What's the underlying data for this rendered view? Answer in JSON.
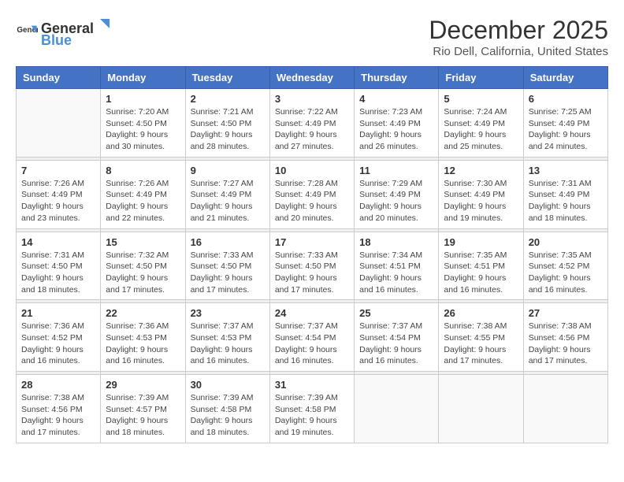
{
  "logo": {
    "general": "General",
    "blue": "Blue"
  },
  "title": "December 2025",
  "subtitle": "Rio Dell, California, United States",
  "headers": [
    "Sunday",
    "Monday",
    "Tuesday",
    "Wednesday",
    "Thursday",
    "Friday",
    "Saturday"
  ],
  "weeks": [
    [
      {
        "day": "",
        "sunrise": "",
        "sunset": "",
        "daylight": ""
      },
      {
        "day": "1",
        "sunrise": "Sunrise: 7:20 AM",
        "sunset": "Sunset: 4:50 PM",
        "daylight": "Daylight: 9 hours and 30 minutes."
      },
      {
        "day": "2",
        "sunrise": "Sunrise: 7:21 AM",
        "sunset": "Sunset: 4:50 PM",
        "daylight": "Daylight: 9 hours and 28 minutes."
      },
      {
        "day": "3",
        "sunrise": "Sunrise: 7:22 AM",
        "sunset": "Sunset: 4:49 PM",
        "daylight": "Daylight: 9 hours and 27 minutes."
      },
      {
        "day": "4",
        "sunrise": "Sunrise: 7:23 AM",
        "sunset": "Sunset: 4:49 PM",
        "daylight": "Daylight: 9 hours and 26 minutes."
      },
      {
        "day": "5",
        "sunrise": "Sunrise: 7:24 AM",
        "sunset": "Sunset: 4:49 PM",
        "daylight": "Daylight: 9 hours and 25 minutes."
      },
      {
        "day": "6",
        "sunrise": "Sunrise: 7:25 AM",
        "sunset": "Sunset: 4:49 PM",
        "daylight": "Daylight: 9 hours and 24 minutes."
      }
    ],
    [
      {
        "day": "7",
        "sunrise": "Sunrise: 7:26 AM",
        "sunset": "Sunset: 4:49 PM",
        "daylight": "Daylight: 9 hours and 23 minutes."
      },
      {
        "day": "8",
        "sunrise": "Sunrise: 7:26 AM",
        "sunset": "Sunset: 4:49 PM",
        "daylight": "Daylight: 9 hours and 22 minutes."
      },
      {
        "day": "9",
        "sunrise": "Sunrise: 7:27 AM",
        "sunset": "Sunset: 4:49 PM",
        "daylight": "Daylight: 9 hours and 21 minutes."
      },
      {
        "day": "10",
        "sunrise": "Sunrise: 7:28 AM",
        "sunset": "Sunset: 4:49 PM",
        "daylight": "Daylight: 9 hours and 20 minutes."
      },
      {
        "day": "11",
        "sunrise": "Sunrise: 7:29 AM",
        "sunset": "Sunset: 4:49 PM",
        "daylight": "Daylight: 9 hours and 20 minutes."
      },
      {
        "day": "12",
        "sunrise": "Sunrise: 7:30 AM",
        "sunset": "Sunset: 4:49 PM",
        "daylight": "Daylight: 9 hours and 19 minutes."
      },
      {
        "day": "13",
        "sunrise": "Sunrise: 7:31 AM",
        "sunset": "Sunset: 4:49 PM",
        "daylight": "Daylight: 9 hours and 18 minutes."
      }
    ],
    [
      {
        "day": "14",
        "sunrise": "Sunrise: 7:31 AM",
        "sunset": "Sunset: 4:50 PM",
        "daylight": "Daylight: 9 hours and 18 minutes."
      },
      {
        "day": "15",
        "sunrise": "Sunrise: 7:32 AM",
        "sunset": "Sunset: 4:50 PM",
        "daylight": "Daylight: 9 hours and 17 minutes."
      },
      {
        "day": "16",
        "sunrise": "Sunrise: 7:33 AM",
        "sunset": "Sunset: 4:50 PM",
        "daylight": "Daylight: 9 hours and 17 minutes."
      },
      {
        "day": "17",
        "sunrise": "Sunrise: 7:33 AM",
        "sunset": "Sunset: 4:50 PM",
        "daylight": "Daylight: 9 hours and 17 minutes."
      },
      {
        "day": "18",
        "sunrise": "Sunrise: 7:34 AM",
        "sunset": "Sunset: 4:51 PM",
        "daylight": "Daylight: 9 hours and 16 minutes."
      },
      {
        "day": "19",
        "sunrise": "Sunrise: 7:35 AM",
        "sunset": "Sunset: 4:51 PM",
        "daylight": "Daylight: 9 hours and 16 minutes."
      },
      {
        "day": "20",
        "sunrise": "Sunrise: 7:35 AM",
        "sunset": "Sunset: 4:52 PM",
        "daylight": "Daylight: 9 hours and 16 minutes."
      }
    ],
    [
      {
        "day": "21",
        "sunrise": "Sunrise: 7:36 AM",
        "sunset": "Sunset: 4:52 PM",
        "daylight": "Daylight: 9 hours and 16 minutes."
      },
      {
        "day": "22",
        "sunrise": "Sunrise: 7:36 AM",
        "sunset": "Sunset: 4:53 PM",
        "daylight": "Daylight: 9 hours and 16 minutes."
      },
      {
        "day": "23",
        "sunrise": "Sunrise: 7:37 AM",
        "sunset": "Sunset: 4:53 PM",
        "daylight": "Daylight: 9 hours and 16 minutes."
      },
      {
        "day": "24",
        "sunrise": "Sunrise: 7:37 AM",
        "sunset": "Sunset: 4:54 PM",
        "daylight": "Daylight: 9 hours and 16 minutes."
      },
      {
        "day": "25",
        "sunrise": "Sunrise: 7:37 AM",
        "sunset": "Sunset: 4:54 PM",
        "daylight": "Daylight: 9 hours and 16 minutes."
      },
      {
        "day": "26",
        "sunrise": "Sunrise: 7:38 AM",
        "sunset": "Sunset: 4:55 PM",
        "daylight": "Daylight: 9 hours and 17 minutes."
      },
      {
        "day": "27",
        "sunrise": "Sunrise: 7:38 AM",
        "sunset": "Sunset: 4:56 PM",
        "daylight": "Daylight: 9 hours and 17 minutes."
      }
    ],
    [
      {
        "day": "28",
        "sunrise": "Sunrise: 7:38 AM",
        "sunset": "Sunset: 4:56 PM",
        "daylight": "Daylight: 9 hours and 17 minutes."
      },
      {
        "day": "29",
        "sunrise": "Sunrise: 7:39 AM",
        "sunset": "Sunset: 4:57 PM",
        "daylight": "Daylight: 9 hours and 18 minutes."
      },
      {
        "day": "30",
        "sunrise": "Sunrise: 7:39 AM",
        "sunset": "Sunset: 4:58 PM",
        "daylight": "Daylight: 9 hours and 18 minutes."
      },
      {
        "day": "31",
        "sunrise": "Sunrise: 7:39 AM",
        "sunset": "Sunset: 4:58 PM",
        "daylight": "Daylight: 9 hours and 19 minutes."
      },
      {
        "day": "",
        "sunrise": "",
        "sunset": "",
        "daylight": ""
      },
      {
        "day": "",
        "sunrise": "",
        "sunset": "",
        "daylight": ""
      },
      {
        "day": "",
        "sunrise": "",
        "sunset": "",
        "daylight": ""
      }
    ]
  ]
}
